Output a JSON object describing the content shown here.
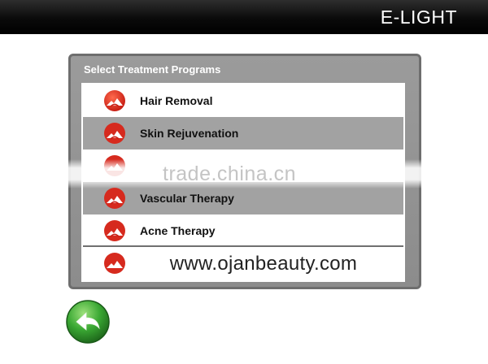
{
  "header": {
    "title": "E-LIGHT"
  },
  "panel": {
    "title": "Select Treatment Programs",
    "items": [
      {
        "label": "Hair Removal",
        "icon": "treatment-icon"
      },
      {
        "label": "Skin Rejuvenation",
        "icon": "treatment-icon"
      },
      {
        "label": "",
        "icon": "treatment-icon"
      },
      {
        "label": "Vascular Therapy",
        "icon": "treatment-icon"
      },
      {
        "label": "Acne Therapy",
        "icon": "treatment-icon"
      },
      {
        "label": "",
        "icon": "treatment-icon"
      }
    ]
  },
  "overlay": {
    "watermark": "trade.china.cn",
    "url": "www.ojanbeauty.com"
  },
  "footer": {
    "back_icon": "back-arrow-icon"
  },
  "colors": {
    "header_bg": "#000000",
    "panel_bg": "#8c8c8c",
    "row_alt": "#a2a2a2",
    "icon_red": "#e0281e",
    "back_green": "#2f9a2c"
  }
}
